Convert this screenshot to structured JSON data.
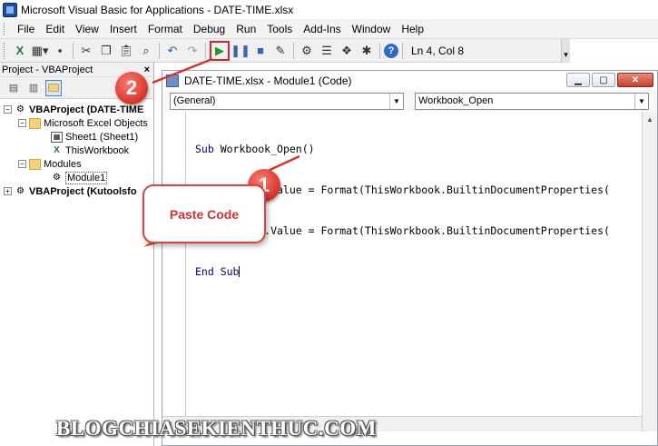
{
  "window": {
    "title": "Microsoft Visual Basic for Applications - DATE-TIME.xlsx"
  },
  "menu": [
    {
      "label": "File"
    },
    {
      "label": "Edit"
    },
    {
      "label": "View"
    },
    {
      "label": "Insert"
    },
    {
      "label": "Format"
    },
    {
      "label": "Debug"
    },
    {
      "label": "Run"
    },
    {
      "label": "Tools"
    },
    {
      "label": "Add-Ins"
    },
    {
      "label": "Window"
    },
    {
      "label": "Help"
    }
  ],
  "toolbar": {
    "status": "Ln 4, Col 8",
    "run_icon": "play-icon",
    "icons": [
      "excel-icon",
      "insert-module-icon",
      "save-icon",
      "cut-icon",
      "copy-icon",
      "paste-icon",
      "find-icon",
      "undo-icon",
      "redo-icon",
      "play-icon",
      "pause-icon",
      "stop-icon",
      "design-mode-icon",
      "project-explorer-icon",
      "properties-icon",
      "object-browser-icon",
      "toolbox-icon",
      "help-icon"
    ]
  },
  "project_panel": {
    "title": "Project - VBAProject",
    "close": "×",
    "tree": {
      "project1": "VBAProject (DATE-TIME",
      "excel_objects": "Microsoft Excel Objects",
      "sheet1": "Sheet1 (Sheet1)",
      "thisworkbook": "ThisWorkbook",
      "modules": "Modules",
      "module1": "Module1",
      "project2": "VBAProject (Kutoolsfo"
    }
  },
  "code_window": {
    "title": "DATE-TIME.xlsx - Module1 (Code)",
    "object_combo": "(General)",
    "procedure_combo": "Workbook_Open",
    "lines": [
      {
        "kw1": "Sub ",
        "text": "Workbook_Open()",
        "kw2": ""
      },
      {
        "kw1": "",
        "text": "Range(\"A1\").Value = Format(ThisWorkbook.BuiltinDocumentProperties(",
        "kw2": ""
      },
      {
        "kw1": "",
        "text": "Range(\"B1\").Value = Format(ThisWorkbook.BuiltinDocumentProperties(",
        "kw2": ""
      },
      {
        "kw1": "End ",
        "text": "",
        "kw2": "Sub"
      }
    ]
  },
  "callouts": {
    "step1": "1",
    "step2": "2",
    "paste_label": "Paste Code"
  },
  "watermark": "BLOGCHIASEKIENTHUC.COM",
  "colors": {
    "callout_red": "#d6342a",
    "keyword_blue": "#00008b",
    "run_green": "#1a9b2f"
  }
}
